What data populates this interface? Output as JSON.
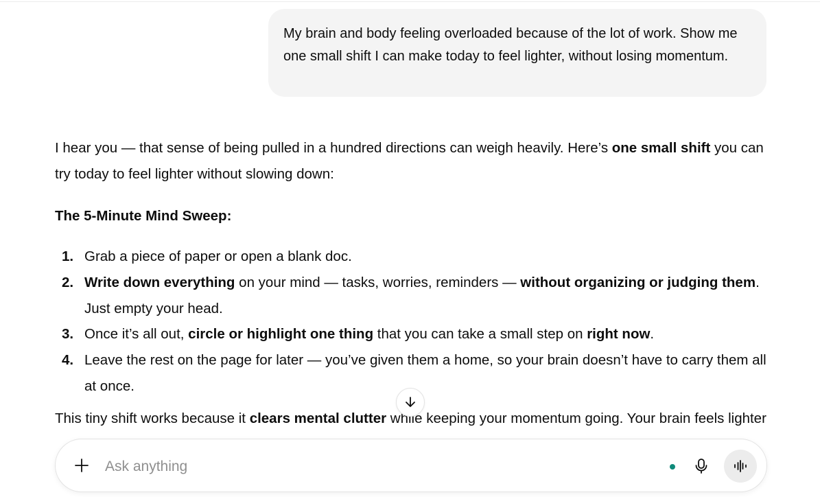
{
  "user_message": {
    "text": "My brain and body feeling overloaded because of the lot of work. Show me one small shift I can make today to feel lighter, without losing momentum."
  },
  "assistant": {
    "intro": {
      "before": "I hear you — that sense of being pulled in a hundred directions can weigh heavily. Here’s ",
      "bold": "one small shift",
      "after": " you can try today to feel lighter without slowing down:"
    },
    "heading": "The 5-Minute Mind Sweep:",
    "steps": [
      {
        "num": "1.",
        "parts": [
          {
            "t": "Grab a piece of paper or open a blank doc."
          }
        ]
      },
      {
        "num": "2.",
        "parts": [
          {
            "t": "Write down everything",
            "b": true
          },
          {
            "t": " on your mind — tasks, worries, reminders — "
          },
          {
            "t": "without organizing or judging them",
            "b": true
          },
          {
            "t": ". Just empty your head."
          }
        ]
      },
      {
        "num": "3.",
        "parts": [
          {
            "t": "Once it’s all out, "
          },
          {
            "t": "circle or highlight one thing",
            "b": true
          },
          {
            "t": " that you can take a small step on "
          },
          {
            "t": "right now",
            "b": true
          },
          {
            "t": "."
          }
        ]
      },
      {
        "num": "4.",
        "parts": [
          {
            "t": "Leave the rest on the page for later — you’ve given them a home, so your brain doesn’t have to carry them all at once."
          }
        ]
      }
    ],
    "closing": {
      "before": "This tiny shift works because it ",
      "bold": "clears mental clutter",
      "after": " while keeping your momentum going. Your brain feels lighter"
    }
  },
  "composer": {
    "placeholder": "Ask anything",
    "value": ""
  },
  "icons": {
    "scroll": "arrow-down-icon",
    "add": "plus-icon",
    "mic": "microphone-icon",
    "voice": "voice-waveform-icon"
  },
  "colors": {
    "bubble": "#f4f4f4",
    "status_dot": "#0f8a7a",
    "voice_button": "#ececec"
  }
}
